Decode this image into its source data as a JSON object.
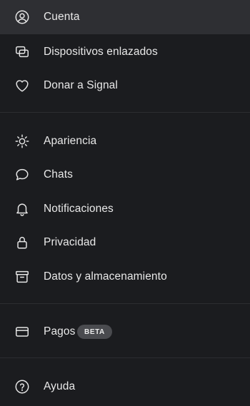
{
  "menu": {
    "items": [
      {
        "label": "Cuenta",
        "icon": "account-icon",
        "selected": true
      },
      {
        "label": "Dispositivos enlazados",
        "icon": "linked-devices-icon"
      },
      {
        "label": "Donar a Signal",
        "icon": "heart-icon"
      },
      {
        "label": "Apariencia",
        "icon": "sun-icon"
      },
      {
        "label": "Chats",
        "icon": "chat-bubble-icon"
      },
      {
        "label": "Notificaciones",
        "icon": "bell-icon"
      },
      {
        "label": "Privacidad",
        "icon": "lock-icon"
      },
      {
        "label": "Datos y almacenamiento",
        "icon": "archive-box-icon"
      },
      {
        "label": "Pagos",
        "icon": "card-icon",
        "badge": "BETA"
      },
      {
        "label": "Ayuda",
        "icon": "help-icon"
      }
    ]
  },
  "colors": {
    "background": "#1b1c1f",
    "selected_background": "#2e2f33",
    "text": "#e9e9e9",
    "badge_background": "#4a4b4f",
    "divider": "#2c2d31"
  }
}
